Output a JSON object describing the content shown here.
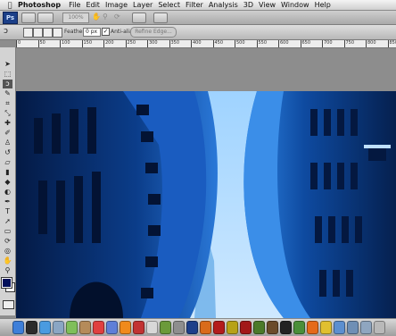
{
  "menubar": {
    "apple": "",
    "app": "Photoshop",
    "items": [
      "File",
      "Edit",
      "Image",
      "Layer",
      "Select",
      "Filter",
      "Analysis",
      "3D",
      "View",
      "Window",
      "Help"
    ]
  },
  "appbar": {
    "logo": "Ps",
    "zoom": "100%"
  },
  "options": {
    "feather_label": "Feather:",
    "feather_value": "0 px",
    "antialias_label": "Anti-alias",
    "antialias_checked": true,
    "refine_label": "Refine Edge..."
  },
  "ruler": {
    "ticks": [
      "0",
      "50",
      "100",
      "150",
      "200",
      "250",
      "300",
      "350",
      "400",
      "450",
      "500",
      "550",
      "600",
      "650",
      "700",
      "750",
      "800",
      "850"
    ]
  },
  "tools": [
    {
      "name": "move-tool-icon",
      "glyph": "➤"
    },
    {
      "name": "marquee-tool-icon",
      "glyph": "⬚"
    },
    {
      "name": "lasso-tool-icon",
      "glyph": "ↄ",
      "selected": true
    },
    {
      "name": "quick-select-tool-icon",
      "glyph": "✎"
    },
    {
      "name": "crop-tool-icon",
      "glyph": "⌗"
    },
    {
      "name": "eyedropper-tool-icon",
      "glyph": "⤡"
    },
    {
      "name": "healing-brush-tool-icon",
      "glyph": "✚"
    },
    {
      "name": "brush-tool-icon",
      "glyph": "✐"
    },
    {
      "name": "clone-stamp-tool-icon",
      "glyph": "♙"
    },
    {
      "name": "history-brush-tool-icon",
      "glyph": "↺"
    },
    {
      "name": "eraser-tool-icon",
      "glyph": "▱"
    },
    {
      "name": "gradient-tool-icon",
      "glyph": "▮"
    },
    {
      "name": "blur-tool-icon",
      "glyph": "◆"
    },
    {
      "name": "dodge-tool-icon",
      "glyph": "◐"
    },
    {
      "name": "pen-tool-icon",
      "glyph": "✒"
    },
    {
      "name": "type-tool-icon",
      "glyph": "T"
    },
    {
      "name": "path-select-tool-icon",
      "glyph": "➚"
    },
    {
      "name": "shape-tool-icon",
      "glyph": "▭"
    },
    {
      "name": "3d-rotate-tool-icon",
      "glyph": "⟳"
    },
    {
      "name": "3d-orbit-tool-icon",
      "glyph": "◎"
    },
    {
      "name": "hand-tool-icon",
      "glyph": "✋"
    },
    {
      "name": "zoom-tool-icon",
      "glyph": "⚲"
    }
  ],
  "colors": {
    "foreground": "#03105a",
    "background": "#ffffff"
  },
  "dock": [
    {
      "name": "finder-icon",
      "color": "#3e7fd9"
    },
    {
      "name": "dashboard-icon",
      "color": "#2b2b2b"
    },
    {
      "name": "safari-icon",
      "color": "#4a9be0"
    },
    {
      "name": "mail-icon",
      "color": "#8aa6c4"
    },
    {
      "name": "ichat-icon",
      "color": "#7fbf5a"
    },
    {
      "name": "address-book-icon",
      "color": "#b58b5a"
    },
    {
      "name": "ical-icon",
      "color": "#e04040"
    },
    {
      "name": "itunes-icon",
      "color": "#5f7fd8"
    },
    {
      "name": "vlc-icon",
      "color": "#f08a1c"
    },
    {
      "name": "app-icon",
      "color": "#c23333"
    },
    {
      "name": "clock-icon",
      "color": "#d8d8d8"
    },
    {
      "name": "preview-icon",
      "color": "#6b9a3a"
    },
    {
      "name": "system-prefs-icon",
      "color": "#8e8e8e"
    },
    {
      "name": "photoshop-icon",
      "color": "#1d3f8a"
    },
    {
      "name": "illustrator-icon",
      "color": "#d96b1a"
    },
    {
      "name": "pdf-icon",
      "color": "#b31c1c"
    },
    {
      "name": "fireworks-icon",
      "color": "#b7a217"
    },
    {
      "name": "flash-icon",
      "color": "#a21818"
    },
    {
      "name": "dreamweaver-icon",
      "color": "#4b7a2a"
    },
    {
      "name": "bridge-icon",
      "color": "#6b4b2a"
    },
    {
      "name": "terminal-icon",
      "color": "#222222"
    },
    {
      "name": "activity-icon",
      "color": "#4a8f3a"
    },
    {
      "name": "firefox-icon",
      "color": "#e56a1a"
    },
    {
      "name": "adium-icon",
      "color": "#e0c030"
    },
    {
      "name": "network-icon",
      "color": "#5c8fd0"
    },
    {
      "name": "downloads-icon",
      "color": "#6f8fb5"
    },
    {
      "name": "documents-icon",
      "color": "#8fa6c0"
    },
    {
      "name": "trash-icon",
      "color": "#b9b9b9"
    }
  ]
}
